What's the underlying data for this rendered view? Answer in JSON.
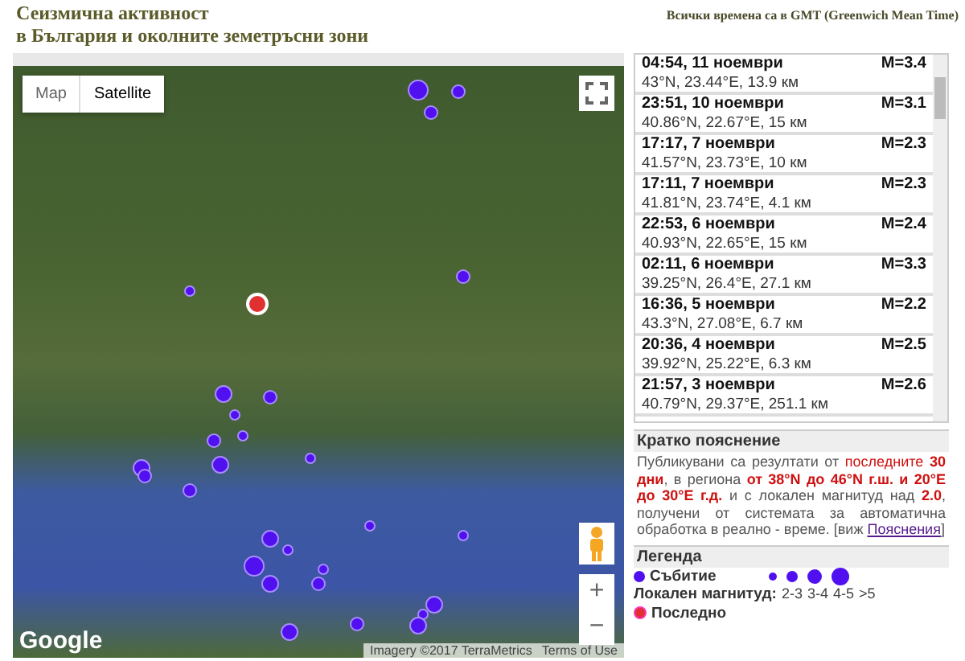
{
  "header": {
    "title_line_1": "Сеизмична активност",
    "title_line_2": "в България и околните земетръсни зони",
    "time_note": "Всички времена са в GMT (Greenwich Mean Time)"
  },
  "map": {
    "type_tabs": [
      {
        "label": "Map",
        "selected": false
      },
      {
        "label": "Satellite",
        "selected": true
      }
    ],
    "logo": "Google",
    "attribution": "Imagery ©2017 TerraMetrics",
    "terms": "Terms of Use",
    "zoom_in": "+",
    "zoom_out": "−"
  },
  "events": [
    {
      "time": "04:54, 11 ноември",
      "magnitude": "M=3.4",
      "location": "43°N, 23.44°E, 13.9 км"
    },
    {
      "time": "23:51, 10 ноември",
      "magnitude": "M=3.1",
      "location": "40.86°N, 22.67°E, 15 км"
    },
    {
      "time": "17:17, 7 ноември",
      "magnitude": "M=2.3",
      "location": "41.57°N, 23.73°E, 10 км"
    },
    {
      "time": "17:11, 7 ноември",
      "magnitude": "M=2.3",
      "location": "41.81°N, 23.74°E, 4.1 км"
    },
    {
      "time": "22:53, 6 ноември",
      "magnitude": "M=2.4",
      "location": "40.93°N, 22.65°E, 15 км"
    },
    {
      "time": "02:11, 6 ноември",
      "magnitude": "M=3.3",
      "location": "39.25°N, 26.4°E, 27.1 км"
    },
    {
      "time": "16:36, 5 ноември",
      "magnitude": "M=2.2",
      "location": "43.3°N, 27.08°E, 6.7 км"
    },
    {
      "time": "20:36, 4 ноември",
      "magnitude": "M=2.5",
      "location": "39.92°N, 25.22°E, 6.3 км"
    },
    {
      "time": "21:57, 3 ноември",
      "magnitude": "M=2.6",
      "location": "40.79°N, 29.37°E, 251.1 км"
    }
  ],
  "explanation": {
    "title": "Кратко пояснение",
    "text": "Публикувани са резултати от *последните* **30 дни**, в региона **от 38°N до 46°N г.ш. и 20°E до 30°E г.д.** и с локален магнитуд над **2.0**, получени от системата за автоматична обработка в реално - време. [виж ",
    "link": "Пояснения",
    "text_end": "]"
  },
  "legend": {
    "title": "Легенда",
    "event_label": "Събитие",
    "magnitude_label": "Локален магнитуд:",
    "magnitude_classes": [
      "2-3",
      "3-4",
      "4-5",
      ">5"
    ],
    "latest_label": "Последно"
  }
}
